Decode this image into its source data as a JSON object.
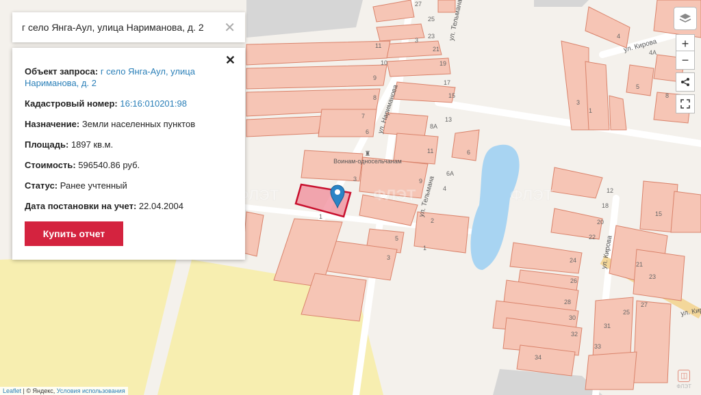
{
  "search": {
    "address": "г село Янга-Аул, улица Нариманова, д. 2",
    "clear_icon": "close-icon"
  },
  "info": {
    "object_label": "Объект запроса:",
    "object_value": "г село Янга-Аул, улица Нариманова, д. 2",
    "cadastral_label": "Кадастровый номер:",
    "cadastral_value": "16:16:010201:98",
    "purpose_label": "Назначение:",
    "purpose_value": "Земли населенных пунктов",
    "area_label": "Площадь:",
    "area_value": "1897 кв.м.",
    "cost_label": "Стоимость:",
    "cost_value": "596540.86 руб.",
    "status_label": "Статус:",
    "status_value": "Ранее учтенный",
    "date_label": "Дата постановки на учет:",
    "date_value": "22.04.2004",
    "buy_label": "Купить отчет"
  },
  "controls": {
    "zoom_in": "+",
    "zoom_out": "−"
  },
  "map": {
    "streets": [
      "ул. Нариманова",
      "ул. Тельмана",
      "ул. Тельмана",
      "ул. Кирова",
      "ул. Кирова",
      "ул. Кир"
    ],
    "monument": "Воинам-односельчанам",
    "house_numbers": [
      "27",
      "25",
      "23",
      "21",
      "19",
      "17",
      "15",
      "11",
      "10",
      "9",
      "8",
      "7",
      "6",
      "8А",
      "13",
      "11",
      "9",
      "6А",
      "4",
      "6",
      "2",
      "1",
      "5",
      "3",
      "1",
      "3",
      "4",
      "4А",
      "5",
      "8",
      "3",
      "1",
      "12",
      "18",
      "20",
      "22",
      "15",
      "24",
      "26",
      "28",
      "30",
      "32",
      "34",
      "21",
      "23",
      "31",
      "33",
      "27",
      "25",
      "3"
    ]
  },
  "attribution": {
    "leaflet": "Leaflet",
    "yandex": "© Яндекс,",
    "terms": "Условия использования"
  },
  "brand": {
    "name": "ФЛЭТ"
  },
  "colors": {
    "plot_fill": "#f6c5b5",
    "plot_stroke": "#d9826a",
    "selected_stroke": "#c8102e",
    "water": "#a8d4f2",
    "accent": "#d4233f"
  }
}
